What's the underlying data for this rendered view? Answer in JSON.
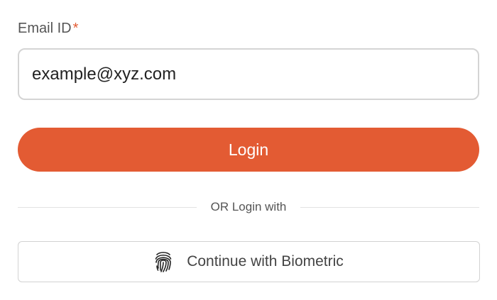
{
  "email_field": {
    "label": "Email ID",
    "required_marker": "*",
    "value": "example@xyz.com"
  },
  "login_button": {
    "label": "Login"
  },
  "divider": {
    "text": "OR Login with"
  },
  "biometric_button": {
    "label": "Continue with Biometric",
    "icon": "fingerprint-icon"
  },
  "colors": {
    "accent": "#e35b33",
    "border": "#d4d4d4",
    "label_text": "#555555"
  }
}
